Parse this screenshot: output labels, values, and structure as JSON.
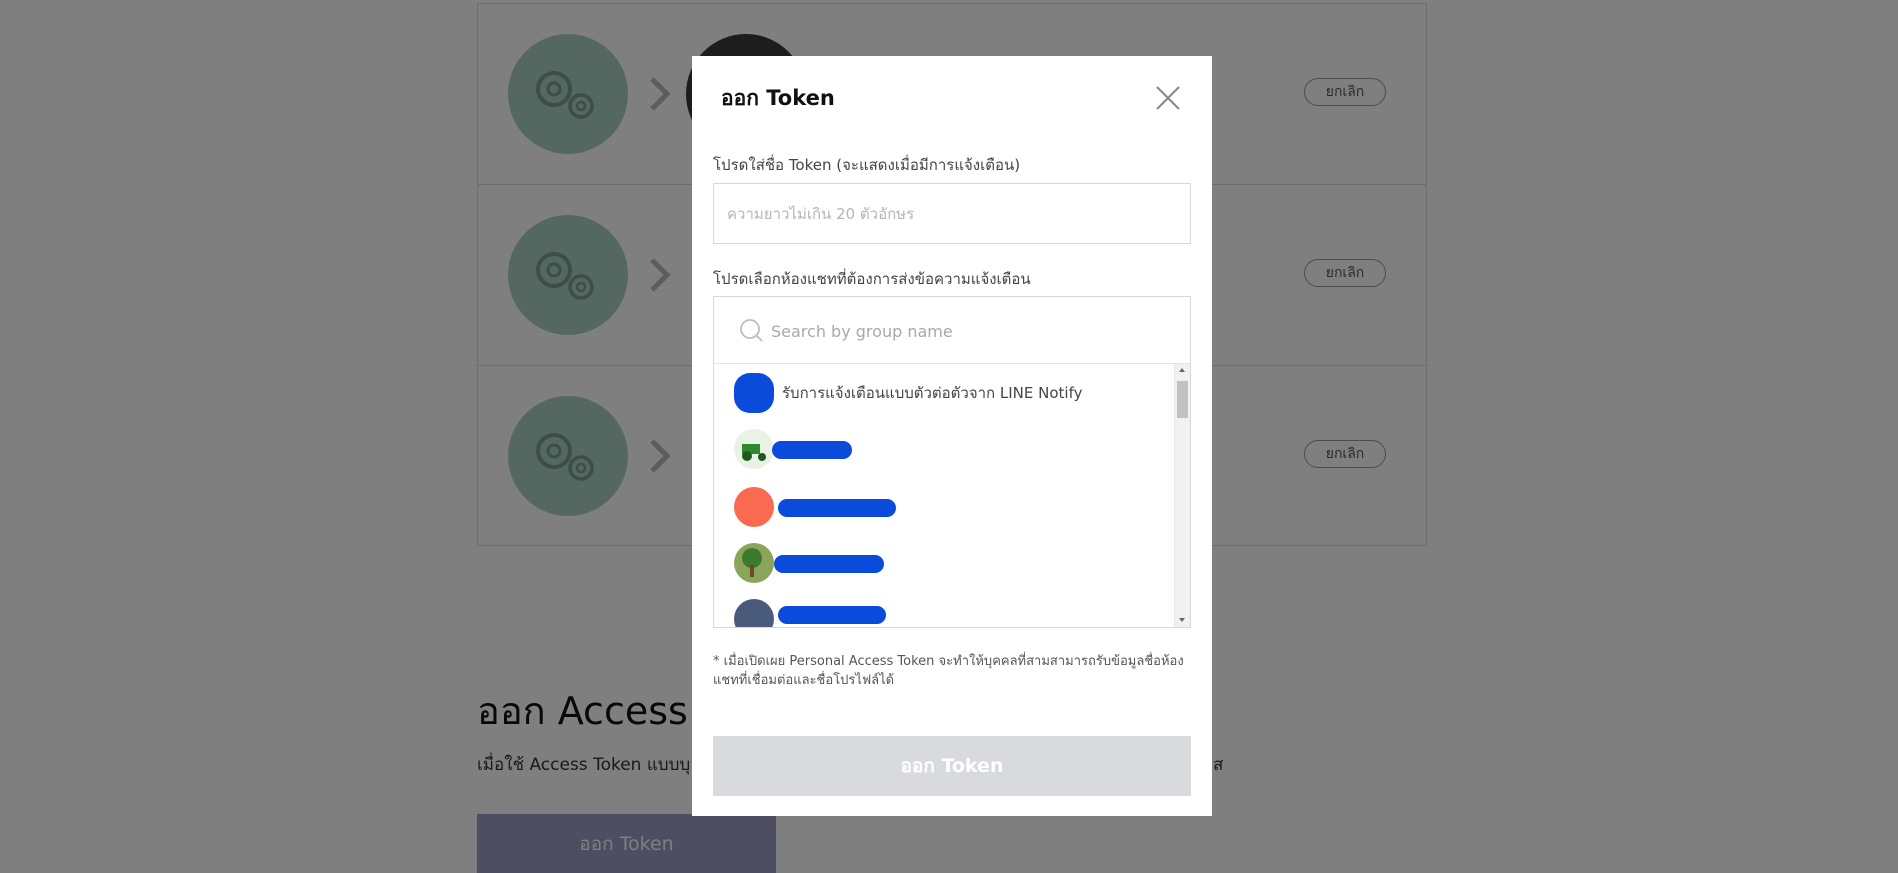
{
  "background": {
    "connections": [
      {
        "revoke_label": "ยกเลิก"
      },
      {
        "revoke_label": "ยกเลิก"
      },
      {
        "revoke_label": "ยกเลิก"
      }
    ],
    "section_title": "ออก Access T",
    "section_desc": "เมื่อใช้ Access Token แบบบุ",
    "section_desc_end": "ส",
    "issue_button_label": "ออก Token"
  },
  "modal": {
    "title": "ออก Token",
    "name_label": "โปรดใส่ชื่อ Token (จะแสดงเมื่อมีการแจ้งเตือน)",
    "name_placeholder": "ความยาวไม่เกิน 20 ตัวอักษร",
    "name_value": "",
    "chat_label": "โปรดเลือกห้องแชทที่ต้องการส่งข้อความแจ้งเตือน",
    "search_placeholder": "Search by group name",
    "chats": [
      {
        "name": "รับการแจ้งเตือนแบบตัวต่อตัวจาก LINE Notify",
        "avatar_color": "#0a4bdc"
      },
      {
        "name": "",
        "avatar_color": "#3c8a3c"
      },
      {
        "name": "",
        "avatar_color": "#fa6a50"
      },
      {
        "name": "",
        "avatar_color": "#6b8a3a"
      },
      {
        "name": "",
        "avatar_color": "#4a5a7a"
      }
    ],
    "note": "* เมื่อเปิดเผย Personal Access Token จะทำให้บุคคลที่สามสามารถรับข้อมูลชื่อห้องแชทที่เชื่อมต่อและชื่อโปรไฟล์ได้",
    "submit_label": "ออก Token"
  },
  "colors": {
    "service_circle": "#aacfc2",
    "overlay": "rgba(0,0,0,0.5)",
    "redaction": "#0a4bdc",
    "submit_disabled": "#d9dadd"
  }
}
